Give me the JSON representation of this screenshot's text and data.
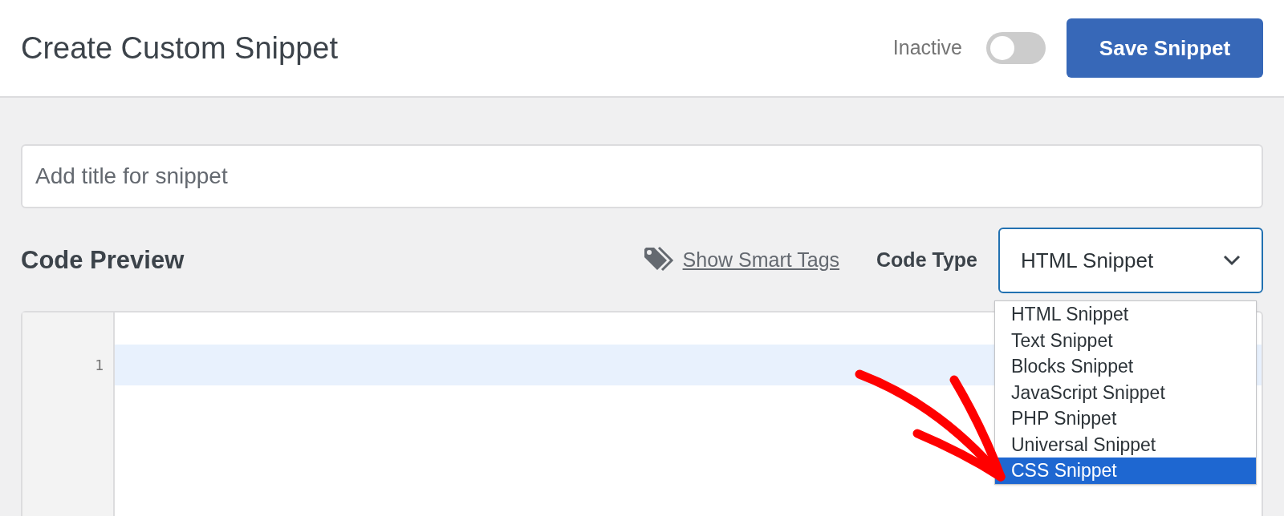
{
  "header": {
    "title": "Create Custom Snippet",
    "status_label": "Inactive",
    "active": false,
    "save_button": "Save Snippet"
  },
  "title_field": {
    "placeholder": "Add title for snippet"
  },
  "code_preview": {
    "heading": "Code Preview",
    "smart_tags_link": "Show Smart Tags",
    "code_type_label": "Code Type",
    "code_type_value": "HTML Snippet"
  },
  "code_type_options": [
    {
      "label": "HTML Snippet",
      "selected": false
    },
    {
      "label": "Text Snippet",
      "selected": false
    },
    {
      "label": "Blocks Snippet",
      "selected": false
    },
    {
      "label": "JavaScript Snippet",
      "selected": false
    },
    {
      "label": "PHP Snippet",
      "selected": false
    },
    {
      "label": "Universal Snippet",
      "selected": false
    },
    {
      "label": "CSS Snippet",
      "selected": true
    }
  ],
  "editor": {
    "line_numbers": [
      "1"
    ]
  }
}
